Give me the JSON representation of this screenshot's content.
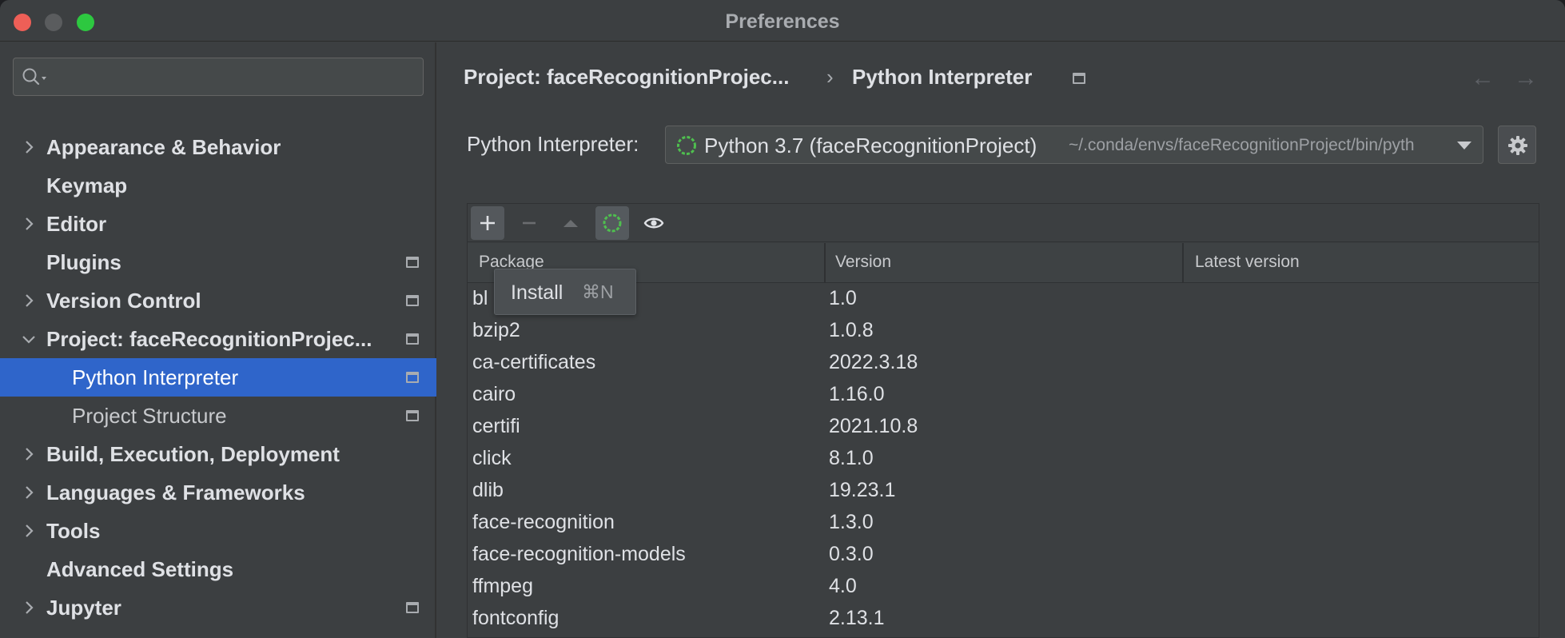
{
  "window": {
    "title": "Preferences"
  },
  "search": {
    "placeholder": "",
    "icon": "search-icon"
  },
  "sidebar": {
    "items": [
      {
        "label": "Appearance & Behavior",
        "expandable": true,
        "expanded": false,
        "bold": true,
        "badge": false
      },
      {
        "label": "Keymap",
        "expandable": false,
        "bold": true,
        "badge": false
      },
      {
        "label": "Editor",
        "expandable": true,
        "expanded": false,
        "bold": true,
        "badge": false
      },
      {
        "label": "Plugins",
        "expandable": false,
        "bold": true,
        "badge": true
      },
      {
        "label": "Version Control",
        "expandable": true,
        "expanded": false,
        "bold": true,
        "badge": true
      },
      {
        "label": "Project: faceRecognitionProjec...",
        "expandable": true,
        "expanded": true,
        "bold": true,
        "badge": true
      },
      {
        "label": "Python Interpreter",
        "child": true,
        "selected": true,
        "badge": true
      },
      {
        "label": "Project Structure",
        "child": true,
        "badge": true
      },
      {
        "label": "Build, Execution, Deployment",
        "expandable": true,
        "expanded": false,
        "bold": true,
        "badge": false
      },
      {
        "label": "Languages & Frameworks",
        "expandable": true,
        "expanded": false,
        "bold": true,
        "badge": false
      },
      {
        "label": "Tools",
        "expandable": true,
        "expanded": false,
        "bold": true,
        "badge": false
      },
      {
        "label": "Advanced Settings",
        "expandable": false,
        "bold": true,
        "badge": false
      },
      {
        "label": "Jupyter",
        "expandable": true,
        "expanded": false,
        "bold": true,
        "badge": true
      }
    ]
  },
  "breadcrumb": {
    "parent": "Project: faceRecognitionProjec...",
    "separator": "›",
    "current": "Python Interpreter",
    "back_icon": "←",
    "forward_icon": "→"
  },
  "interpreter": {
    "label": "Python Interpreter:",
    "name": "Python 3.7 (faceRecognitionProject)",
    "path": "~/.conda/envs/faceRecognitionProject/bin/pyth"
  },
  "toolbar": {
    "buttons": [
      "plus-icon",
      "minus-icon",
      "upgrade-icon",
      "conda-icon",
      "eye-icon"
    ]
  },
  "table": {
    "columns": [
      "Package",
      "Version",
      "Latest version"
    ],
    "rows": [
      [
        "bl",
        "1.0",
        ""
      ],
      [
        "bzip2",
        "1.0.8",
        ""
      ],
      [
        "ca-certificates",
        "2022.3.18",
        ""
      ],
      [
        "cairo",
        "1.16.0",
        ""
      ],
      [
        "certifi",
        "2021.10.8",
        ""
      ],
      [
        "click",
        "8.1.0",
        ""
      ],
      [
        "dlib",
        "19.23.1",
        ""
      ],
      [
        "face-recognition",
        "1.3.0",
        ""
      ],
      [
        "face-recognition-models",
        "0.3.0",
        ""
      ],
      [
        "ffmpeg",
        "4.0",
        ""
      ],
      [
        "fontconfig",
        "2.13.1",
        ""
      ]
    ]
  },
  "tooltip": {
    "label": "Install",
    "shortcut": "⌘N"
  },
  "colors": {
    "selection": "#2f65ca",
    "background": "#3c3f41",
    "conda_green": "#4fbf4f"
  }
}
